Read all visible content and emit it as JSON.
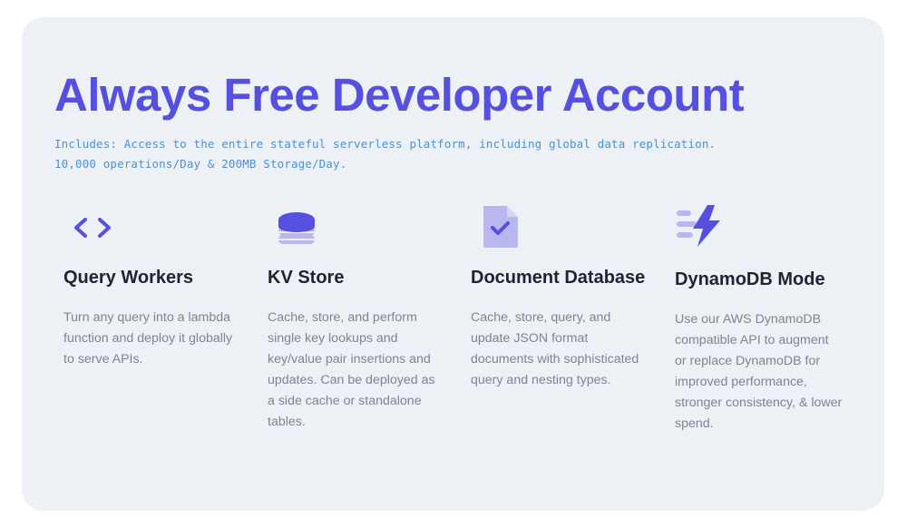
{
  "hero": {
    "title": "Always Free Developer Account",
    "subtitle_line1": "Includes: Access to the entire stateful serverless platform, including global data replication.",
    "subtitle_line2": "10,000 operations/Day & 200MB Storage/Day."
  },
  "features": [
    {
      "icon": "code-brackets-icon",
      "title": "Query Workers",
      "description": "Turn any query into a lambda function and deploy it globally to serve APIs."
    },
    {
      "icon": "database-stack-icon",
      "title": "KV Store",
      "description": "Cache, store, and perform single key lookups and key/value pair insertions and updates. Can be deployed as a side cache or standalone tables."
    },
    {
      "icon": "document-check-icon",
      "title": "Document Database",
      "description": "Cache, store, query, and update JSON format documents with sophisticated query and nesting types."
    },
    {
      "icon": "lightning-bolt-icon",
      "title": "DynamoDB Mode",
      "description": "Use our AWS DynamoDB compatible API to augment or replace DynamoDB for improved performance, stronger consistency, & lower spend."
    }
  ],
  "colors": {
    "accent": "#5550e0",
    "accent_light": "#b9b7f2",
    "subtitle": "#4f8fd0",
    "card_bg": "#edf1f6",
    "heading": "#1d2433",
    "body_text": "#7c8594"
  }
}
